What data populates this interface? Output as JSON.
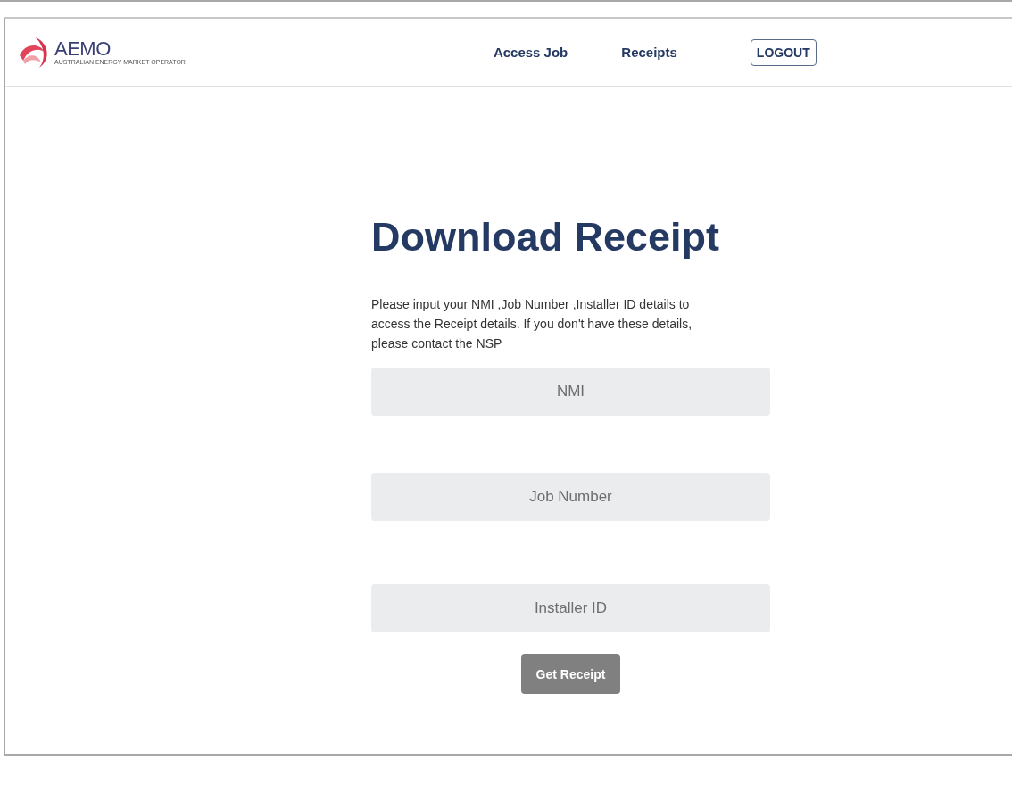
{
  "header": {
    "logo": {
      "wordmark": "AEMO",
      "tagline": "AUSTRALIAN ENERGY MARKET OPERATOR"
    },
    "nav": [
      {
        "label": "Access Job",
        "kind": "link"
      },
      {
        "label": "Receipts",
        "kind": "link"
      },
      {
        "label": "LOGOUT",
        "kind": "button"
      }
    ]
  },
  "main": {
    "title": "Download Receipt",
    "intro": "Please input your NMI ,Job Number ,Installer ID details to access the Receipt details. If you don't have these details, please contact the NSP",
    "fields": [
      {
        "placeholder": "NMI"
      },
      {
        "placeholder": "Job Number"
      },
      {
        "placeholder": "Installer ID"
      }
    ],
    "submit": "Get Receipt"
  }
}
